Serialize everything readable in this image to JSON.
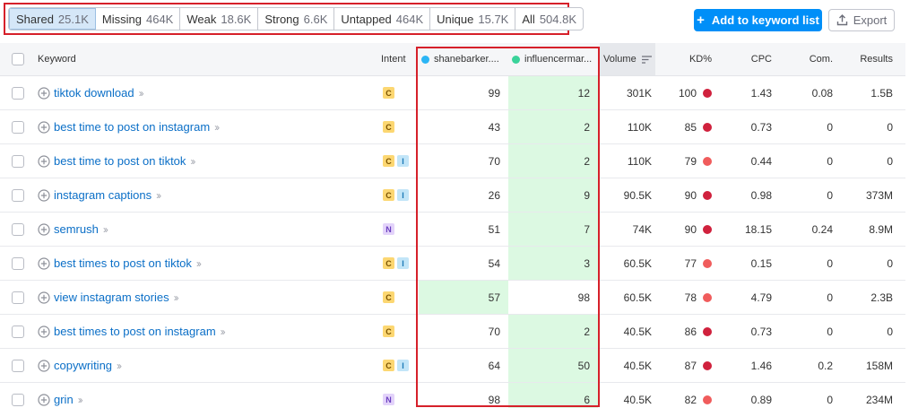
{
  "filters": [
    {
      "label": "Shared",
      "count": "25.1K",
      "active": true
    },
    {
      "label": "Missing",
      "count": "464K"
    },
    {
      "label": "Weak",
      "count": "18.6K"
    },
    {
      "label": "Strong",
      "count": "6.6K"
    },
    {
      "label": "Untapped",
      "count": "464K"
    },
    {
      "label": "Unique",
      "count": "15.7K"
    },
    {
      "label": "All",
      "count": "504.8K"
    }
  ],
  "actions": {
    "add_label": "Add to keyword list",
    "export_label": "Export"
  },
  "colors": {
    "accent": "#008ff8",
    "highlight": "#d6202a",
    "domain1": "#2bb5f5",
    "domain2": "#3ad39a",
    "kd_dark": "#d0213d",
    "kd_light": "#f05c5c",
    "share_bg": "#dcf9e2"
  },
  "header": {
    "keyword": "Keyword",
    "intent": "Intent",
    "domain1": "shanebarker....",
    "domain2": "influencermar...",
    "volume": "Volume",
    "kd": "KD%",
    "cpc": "CPC",
    "com": "Com.",
    "results": "Results"
  },
  "rows": [
    {
      "keyword": "tiktok download",
      "intents": [
        "C"
      ],
      "d1": "99",
      "d2": "12",
      "green": "d2",
      "volume": "301K",
      "kd": "100",
      "kd_color": "dark",
      "cpc": "1.43",
      "com": "0.08",
      "results": "1.5B"
    },
    {
      "keyword": "best time to post on instagram",
      "intents": [
        "C"
      ],
      "d1": "43",
      "d2": "2",
      "green": "d2",
      "volume": "110K",
      "kd": "85",
      "kd_color": "dark",
      "cpc": "0.73",
      "com": "0",
      "results": "0"
    },
    {
      "keyword": "best time to post on tiktok",
      "intents": [
        "C",
        "I"
      ],
      "d1": "70",
      "d2": "2",
      "green": "d2",
      "volume": "110K",
      "kd": "79",
      "kd_color": "light",
      "cpc": "0.44",
      "com": "0",
      "results": "0"
    },
    {
      "keyword": "instagram captions",
      "intents": [
        "C",
        "I"
      ],
      "d1": "26",
      "d2": "9",
      "green": "d2",
      "volume": "90.5K",
      "kd": "90",
      "kd_color": "dark",
      "cpc": "0.98",
      "com": "0",
      "results": "373M"
    },
    {
      "keyword": "semrush",
      "intents": [
        "N"
      ],
      "d1": "51",
      "d2": "7",
      "green": "d2",
      "volume": "74K",
      "kd": "90",
      "kd_color": "dark",
      "cpc": "18.15",
      "com": "0.24",
      "results": "8.9M"
    },
    {
      "keyword": "best times to post on tiktok",
      "intents": [
        "C",
        "I"
      ],
      "d1": "54",
      "d2": "3",
      "green": "d2",
      "volume": "60.5K",
      "kd": "77",
      "kd_color": "light",
      "cpc": "0.15",
      "com": "0",
      "results": "0"
    },
    {
      "keyword": "view instagram stories",
      "intents": [
        "C"
      ],
      "d1": "57",
      "d2": "98",
      "green": "d1",
      "volume": "60.5K",
      "kd": "78",
      "kd_color": "light",
      "cpc": "4.79",
      "com": "0",
      "results": "2.3B"
    },
    {
      "keyword": "best times to post on instagram",
      "intents": [
        "C"
      ],
      "d1": "70",
      "d2": "2",
      "green": "d2",
      "volume": "40.5K",
      "kd": "86",
      "kd_color": "dark",
      "cpc": "0.73",
      "com": "0",
      "results": "0"
    },
    {
      "keyword": "copywriting",
      "intents": [
        "C",
        "I"
      ],
      "d1": "64",
      "d2": "50",
      "green": "d2",
      "volume": "40.5K",
      "kd": "87",
      "kd_color": "dark",
      "cpc": "1.46",
      "com": "0.2",
      "results": "158M"
    },
    {
      "keyword": "grin",
      "intents": [
        "N"
      ],
      "d1": "98",
      "d2": "6",
      "green": "d2",
      "volume": "40.5K",
      "kd": "82",
      "kd_color": "light",
      "cpc": "0.89",
      "com": "0",
      "results": "234M"
    }
  ]
}
